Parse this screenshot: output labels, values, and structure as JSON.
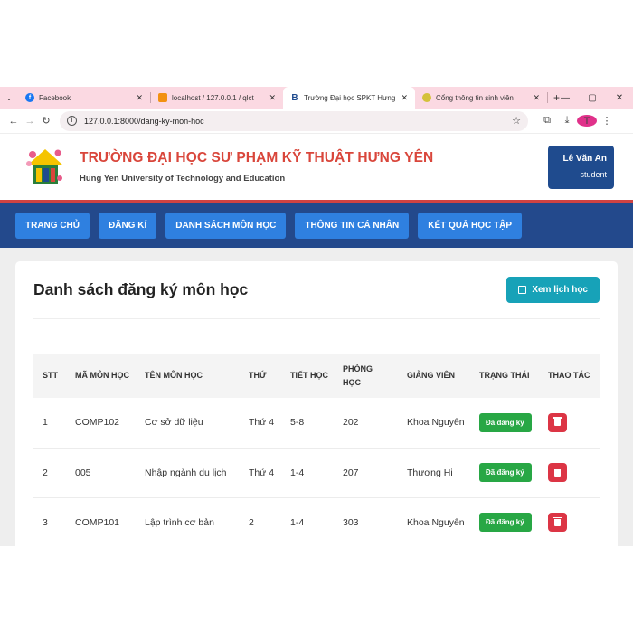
{
  "browser": {
    "tabs": [
      {
        "title": "Facebook",
        "favicon": "facebook-icon",
        "color": "#1877f2",
        "active": false
      },
      {
        "title": "localhost / 127.0.0.1 / qlct",
        "favicon": "phpmyadmin-icon",
        "color": "#f29111",
        "active": false
      },
      {
        "title": "Trường Đại học SPKT Hưng Yên",
        "favicon": "bootstrap-icon",
        "color": "#1f4b8e",
        "active": true
      },
      {
        "title": "Cổng thông tin sinh viên",
        "favicon": "portal-icon",
        "color": "#d4c13a",
        "active": false
      }
    ],
    "url": "127.0.0.1:8000/dang-ky-mon-hoc",
    "profile_initial": "T"
  },
  "header": {
    "title": "TRƯỜNG ĐẠI HỌC SƯ PHẠM KỸ THUẬT HƯNG YÊN",
    "subtitle": "Hung Yen University of Technology and Education",
    "user_name": "Lê Văn An",
    "user_role": "student"
  },
  "nav": {
    "items": [
      "TRANG CHỦ",
      "ĐĂNG KÍ",
      "DANH SÁCH MÔN HỌC",
      "THÔNG TIN CÁ NHÂN",
      "KẾT QUẢ HỌC TẬP"
    ]
  },
  "page": {
    "title": "Danh sách đăng ký môn học",
    "schedule_button": "Xem lịch học"
  },
  "table": {
    "headers": [
      "STT",
      "MÃ MÔN HỌC",
      "TÊN MÔN HỌC",
      "THỨ",
      "TIẾT HỌC",
      "PHÒNG HỌC",
      "GIẢNG VIÊN",
      "TRẠNG THÁI",
      "THAO TÁC"
    ],
    "rows": [
      {
        "stt": "1",
        "code": "COMP102",
        "name": "Cơ sở dữ liệu",
        "day": "Thứ 4",
        "period": "5-8",
        "room": "202",
        "teacher": "Khoa Nguyên",
        "status": "Đã đăng ký"
      },
      {
        "stt": "2",
        "code": "005",
        "name": "Nhập ngành du lịch",
        "day": "Thứ 4",
        "period": "1-4",
        "room": "207",
        "teacher": "Thương Hi",
        "status": "Đã đăng ký"
      },
      {
        "stt": "3",
        "code": "COMP101",
        "name": "Lập trình cơ bản",
        "day": "2",
        "period": "1-4",
        "room": "303",
        "teacher": "Khoa Nguyên",
        "status": "Đã đăng ký"
      }
    ]
  },
  "colors": {
    "nav_bar": "#23498c",
    "nav_button": "#2f80e0",
    "header_title": "#d9463b",
    "status_badge": "#28a745",
    "delete_button": "#dc3545",
    "schedule_button": "#17a2b8"
  }
}
